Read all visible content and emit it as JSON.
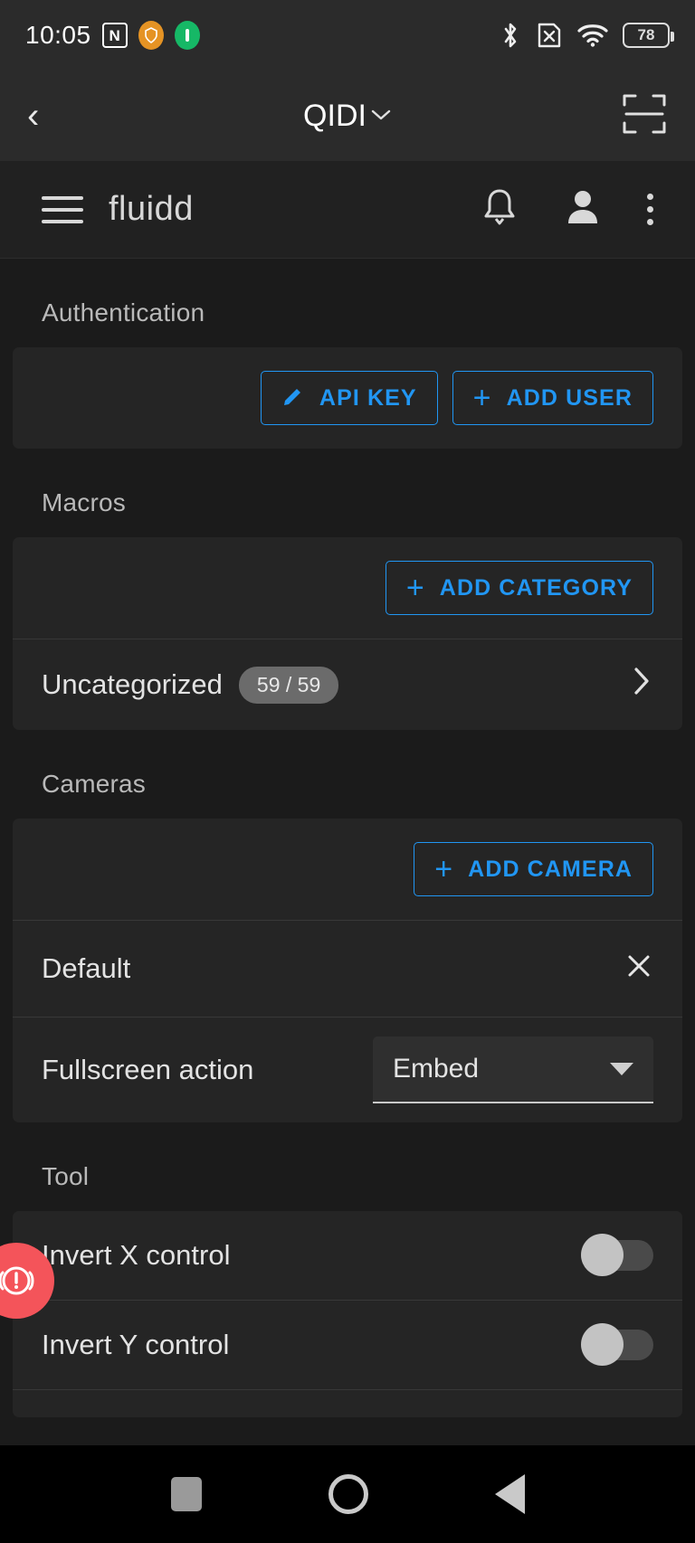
{
  "status_bar": {
    "time": "10:05",
    "nfc_icon": "nfc-icon",
    "app_icon_1": "orange-shield-icon",
    "app_icon_2": "green-capsule-icon",
    "bluetooth_icon": "bluetooth-icon",
    "sim_off_icon": "sim-card-off-icon",
    "wifi_icon": "wifi-icon",
    "battery_level": "78"
  },
  "device_bar": {
    "back_label": "‹",
    "title": "QIDI",
    "caret": "⌄",
    "scan_icon": "scan-frame-icon"
  },
  "app_bar": {
    "menu_icon": "hamburger-menu-icon",
    "brand": "fluidd",
    "bell_icon": "notifications-bell-icon",
    "account_icon": "account-person-icon",
    "overflow_icon": "more-vertical-icon"
  },
  "sections": {
    "authentication": {
      "title": "Authentication",
      "api_key_button": "API KEY",
      "api_key_icon": "pencil-edit-icon",
      "add_user_button": "ADD USER",
      "add_user_icon": "plus-icon"
    },
    "macros": {
      "title": "Macros",
      "add_category_button": "ADD CATEGORY",
      "add_category_icon": "plus-icon",
      "rows": [
        {
          "label": "Uncategorized",
          "badge": "59 / 59",
          "chevron": "›"
        }
      ]
    },
    "cameras": {
      "title": "Cameras",
      "add_camera_button": "ADD CAMERA",
      "add_camera_icon": "plus-icon",
      "camera_name": "Default",
      "remove_icon": "close-x-icon",
      "fullscreen_action_label": "Fullscreen action",
      "fullscreen_action_value": "Embed"
    },
    "tool": {
      "title": "Tool",
      "rows": [
        {
          "label": "Invert X control",
          "enabled": false
        },
        {
          "label": "Invert Y control",
          "enabled": false
        }
      ]
    }
  },
  "fab": {
    "name": "emergency-stop-button",
    "color": "#f4545a"
  },
  "nav_bar": {
    "recents": "recents-square-icon",
    "home": "home-circle-icon",
    "back": "back-triangle-icon"
  },
  "colors": {
    "accent_blue": "#2196f3",
    "background": "#1b1b1b",
    "card": "#252525",
    "emergency_red": "#f4545a"
  }
}
